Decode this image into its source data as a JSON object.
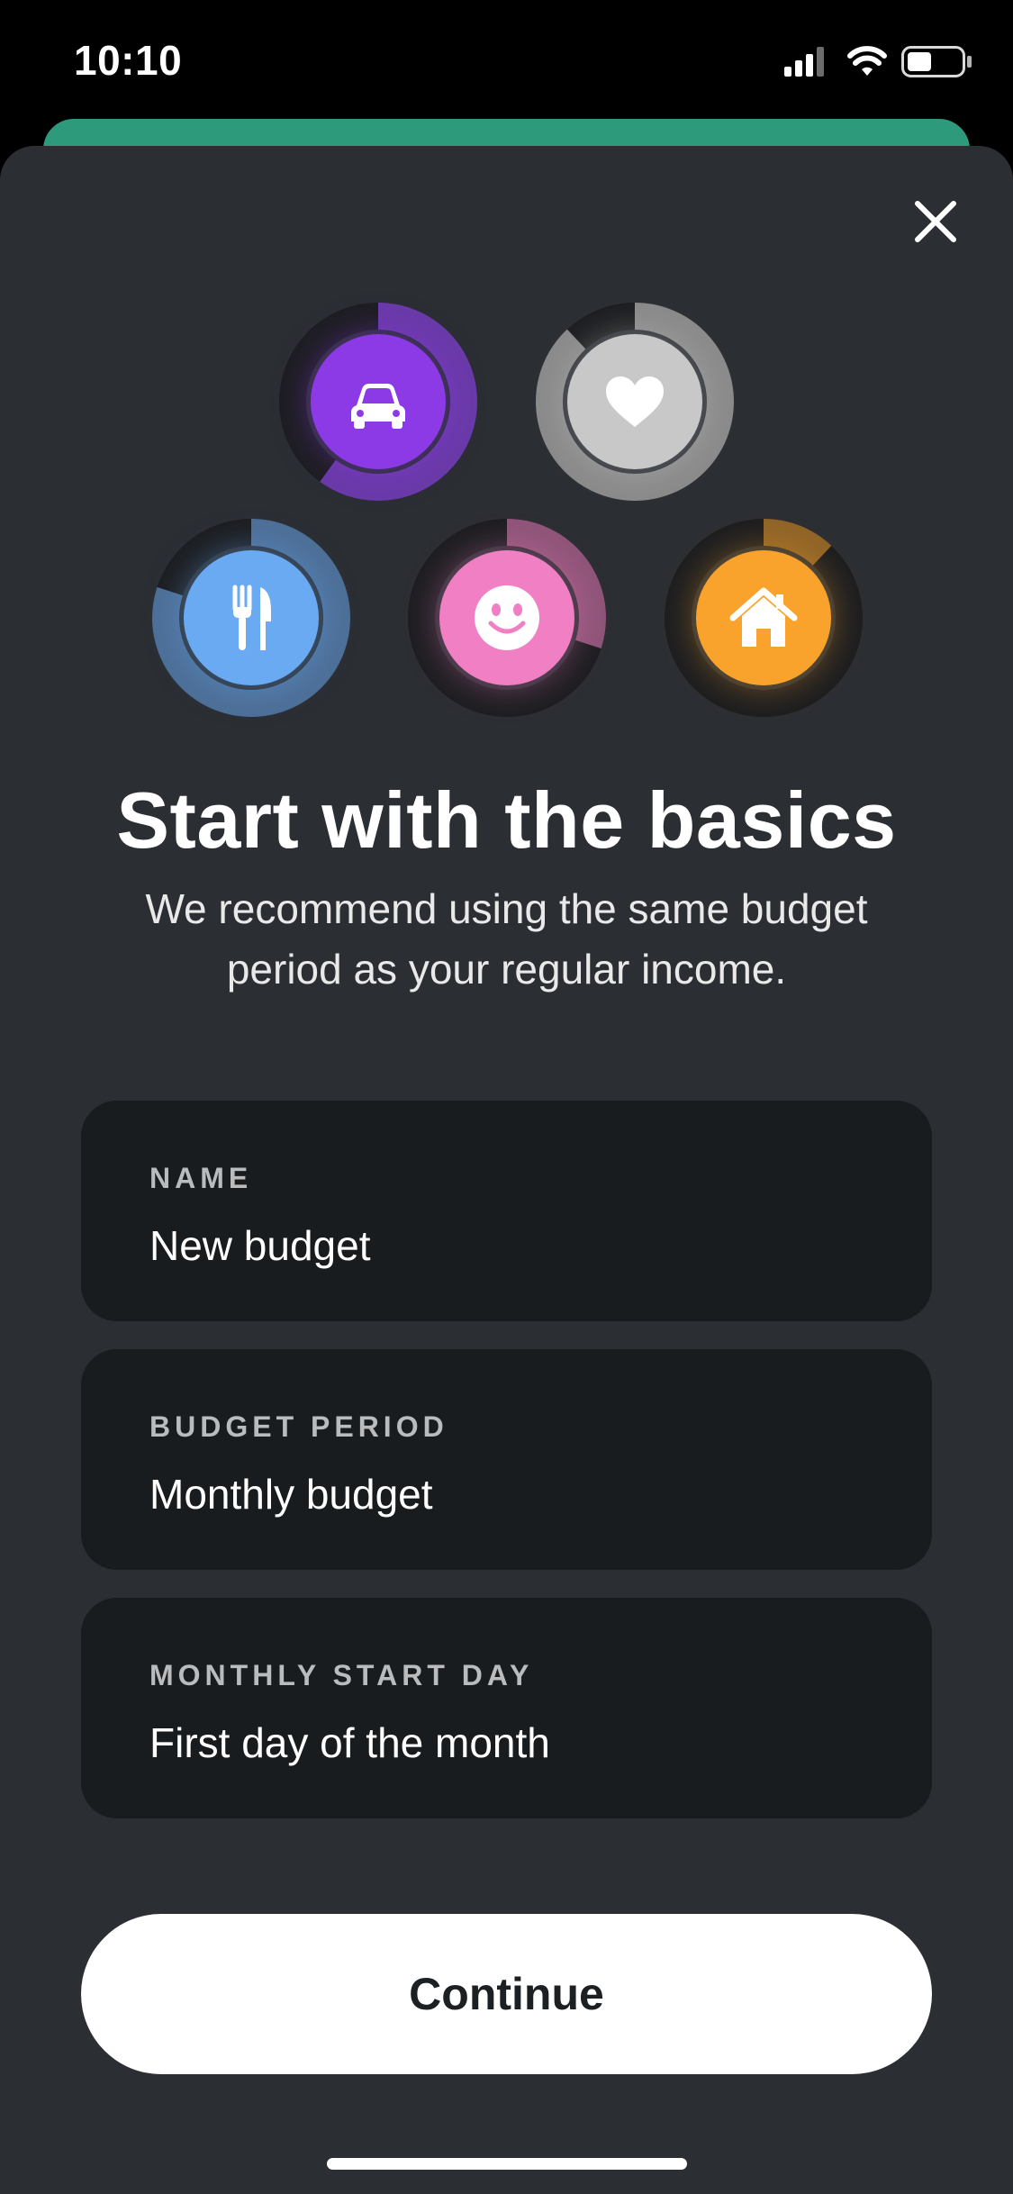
{
  "status_bar": {
    "time": "10:10",
    "icons": [
      "cellular-signal-icon",
      "wifi-icon",
      "battery-icon"
    ]
  },
  "modal": {
    "close_icon": "close-icon",
    "categories": [
      {
        "name": "transportation",
        "icon": "car-icon",
        "color": "#8c3ae6",
        "progress": 0.6
      },
      {
        "name": "health",
        "icon": "heart-icon",
        "color": "#c8c8c8",
        "progress": 0.88
      },
      {
        "name": "food",
        "icon": "fork-knife-icon",
        "color": "#6aaaf2",
        "progress": 0.8
      },
      {
        "name": "entertainment",
        "icon": "smiley-icon",
        "color": "#f07fc4",
        "progress": 0.3
      },
      {
        "name": "home",
        "icon": "house-icon",
        "color": "#f9a32c",
        "progress": 0.12
      }
    ],
    "title": "Start with the basics",
    "subtitle": "We recommend using the same budget period as your regular income.",
    "fields": {
      "name": {
        "label": "NAME",
        "value": "New budget"
      },
      "period": {
        "label": "BUDGET PERIOD",
        "value": "Monthly budget"
      },
      "start_day": {
        "label": "MONTHLY START DAY",
        "value": "First day of the month"
      }
    },
    "continue_label": "Continue"
  },
  "colors": {
    "sheet_background": "#2b2e33",
    "field_background": "#181c1f",
    "accent_green": "#2e9a7c"
  }
}
